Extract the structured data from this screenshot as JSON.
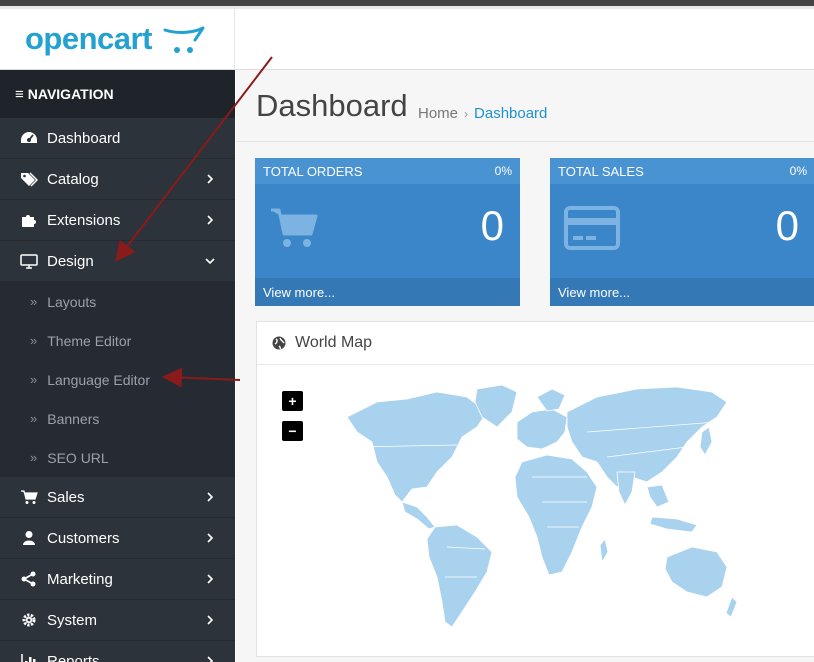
{
  "header": {
    "logo_text": "opencart"
  },
  "sidebar": {
    "heading": "NAVIGATION",
    "items": [
      {
        "label": "Dashboard",
        "icon": "dashboard-icon"
      },
      {
        "label": "Catalog",
        "icon": "tags-icon"
      },
      {
        "label": "Extensions",
        "icon": "puzzle-icon"
      },
      {
        "label": "Design",
        "icon": "monitor-icon"
      }
    ],
    "design_sub": [
      {
        "label": "Layouts"
      },
      {
        "label": "Theme Editor"
      },
      {
        "label": "Language Editor"
      },
      {
        "label": "Banners"
      },
      {
        "label": "SEO URL"
      }
    ],
    "items_after": [
      {
        "label": "Sales",
        "icon": "cart-icon"
      },
      {
        "label": "Customers",
        "icon": "user-icon"
      },
      {
        "label": "Marketing",
        "icon": "share-icon"
      },
      {
        "label": "System",
        "icon": "gear-icon"
      },
      {
        "label": "Reports",
        "icon": "bar-chart-icon"
      }
    ]
  },
  "page": {
    "title": "Dashboard",
    "breadcrumb": {
      "home": "Home",
      "current": "Dashboard"
    }
  },
  "tiles": [
    {
      "title": "TOTAL ORDERS",
      "percent": "0%",
      "value": "0",
      "link": "View more...",
      "icon": "shopping-cart-icon"
    },
    {
      "title": "TOTAL SALES",
      "percent": "0%",
      "value": "0",
      "link": "View more...",
      "icon": "credit-card-icon"
    }
  ],
  "map_panel": {
    "title": "World Map",
    "zoom_in": "+",
    "zoom_out": "−"
  },
  "colors": {
    "brand": "#23a1d1",
    "tile": "#3b86c8",
    "sidebar": "#2d333b",
    "map_land": "#a9d2ef",
    "annotation": "#8b1a1a"
  }
}
